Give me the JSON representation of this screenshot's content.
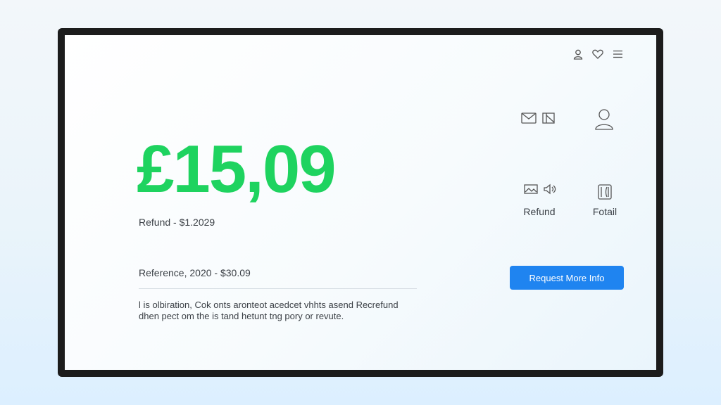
{
  "icons": {
    "top": [
      "user-icon",
      "heart-icon",
      "menu-icon"
    ],
    "side": [
      "mail-icon",
      "document-icon",
      "user-icon",
      "image-icon",
      "speaker-icon",
      "wallet-icon"
    ]
  },
  "colors": {
    "amount": "#1ed35f",
    "button": "#1f84f0",
    "bezel": "#1c1c1c"
  },
  "main": {
    "amount": "£15,09",
    "refund_line": "Refund - $1.2029",
    "reference_line": "Reference, 2020 - $30.09",
    "description": [
      "l is olbiration, Cok onts aronteot acedcet vhhts asend Recrefund",
      "dhen pect om the is tand hetunt tng pory or revute."
    ]
  },
  "side": {
    "refund_label": "Refund",
    "fotail_label": "Fotail"
  },
  "cta": {
    "label": "Request More Info"
  }
}
